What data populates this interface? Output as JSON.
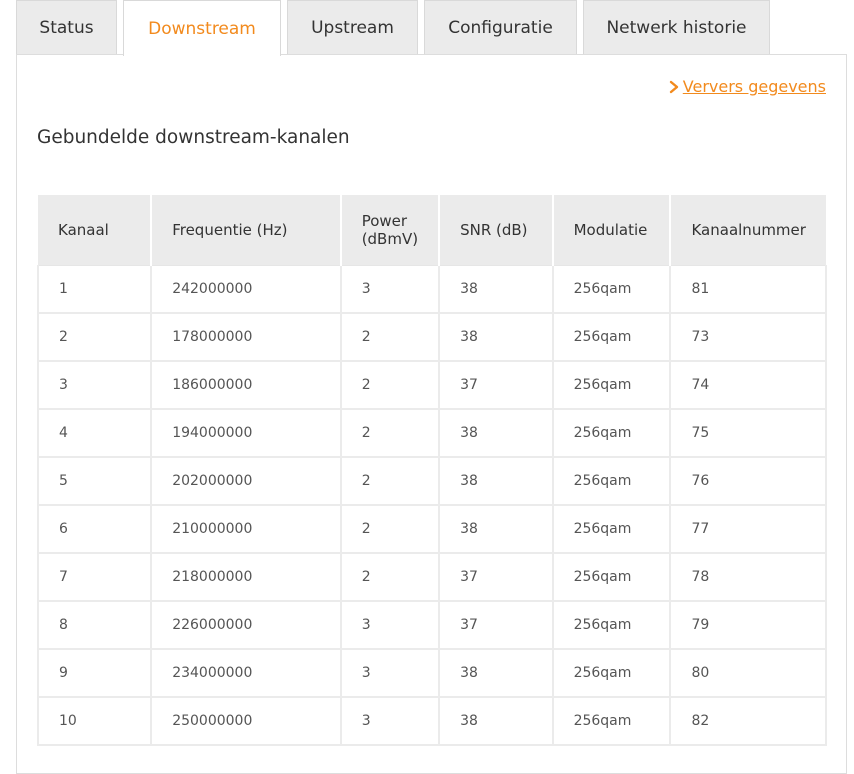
{
  "tabs": [
    {
      "label": "Status",
      "active": false
    },
    {
      "label": "Downstream",
      "active": true
    },
    {
      "label": "Upstream",
      "active": false
    },
    {
      "label": "Configuratie",
      "active": false
    },
    {
      "label": "Netwerk historie",
      "active": false
    }
  ],
  "refresh": {
    "label": "Ververs gegevens",
    "icon": "chevron-right-icon"
  },
  "section_title": "Gebundelde downstream-kanalen",
  "table": {
    "headers": [
      "Kanaal",
      "Frequentie (Hz)",
      "Power (dBmV)",
      "SNR (dB)",
      "Modulatie",
      "Kanaalnummer"
    ],
    "rows": [
      [
        "1",
        "242000000",
        "3",
        "38",
        "256qam",
        "81"
      ],
      [
        "2",
        "178000000",
        "2",
        "38",
        "256qam",
        "73"
      ],
      [
        "3",
        "186000000",
        "2",
        "37",
        "256qam",
        "74"
      ],
      [
        "4",
        "194000000",
        "2",
        "38",
        "256qam",
        "75"
      ],
      [
        "5",
        "202000000",
        "2",
        "38",
        "256qam",
        "76"
      ],
      [
        "6",
        "210000000",
        "2",
        "38",
        "256qam",
        "77"
      ],
      [
        "7",
        "218000000",
        "2",
        "37",
        "256qam",
        "78"
      ],
      [
        "8",
        "226000000",
        "3",
        "37",
        "256qam",
        "79"
      ],
      [
        "9",
        "234000000",
        "3",
        "38",
        "256qam",
        "80"
      ],
      [
        "10",
        "250000000",
        "3",
        "38",
        "256qam",
        "82"
      ]
    ]
  },
  "colors": {
    "accent": "#f28a1d",
    "tab_bg": "#ebebeb",
    "text": "#333333"
  }
}
